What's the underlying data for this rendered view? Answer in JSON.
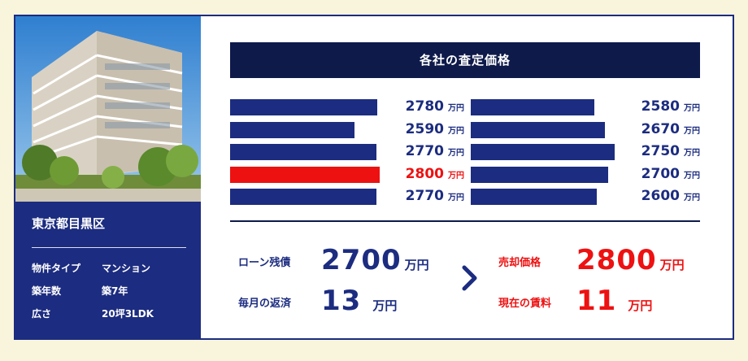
{
  "property": {
    "location": "東京都目黒区",
    "rows": [
      {
        "label": "物件タイプ",
        "value": "マンション"
      },
      {
        "label": "築年数",
        "value": "築7年"
      },
      {
        "label": "広さ",
        "value": "20坪3LDK"
      }
    ]
  },
  "assessment": {
    "title": "各社の査定価格",
    "unit": "万円",
    "left": [
      {
        "value": "2780",
        "amount": 2780,
        "highlight": false
      },
      {
        "value": "2590",
        "amount": 2590,
        "highlight": false
      },
      {
        "value": "2770",
        "amount": 2770,
        "highlight": false
      },
      {
        "value": "2800",
        "amount": 2800,
        "highlight": true
      },
      {
        "value": "2770",
        "amount": 2770,
        "highlight": false
      }
    ],
    "right": [
      {
        "value": "2580",
        "amount": 2580
      },
      {
        "value": "2670",
        "amount": 2670
      },
      {
        "value": "2750",
        "amount": 2750
      },
      {
        "value": "2700",
        "amount": 2700
      },
      {
        "value": "2600",
        "amount": 2600
      }
    ]
  },
  "summary": {
    "loan_label": "ローン残債",
    "loan_value": "2700",
    "loan_unit": "万円",
    "monthly_label": "毎月の返済",
    "monthly_value": "13",
    "monthly_unit": "万円",
    "sale_label": "売却価格",
    "sale_value": "2800",
    "sale_unit": "万円",
    "rent_label": "現在の賃料",
    "rent_value": "11",
    "rent_unit": "万円"
  },
  "colors": {
    "navy": "#1c2c80",
    "dark_navy": "#0e1a4a",
    "red": "#ee1111",
    "background": "#f9f4dc"
  },
  "icons": {
    "arrow": "chevron-right-icon"
  }
}
